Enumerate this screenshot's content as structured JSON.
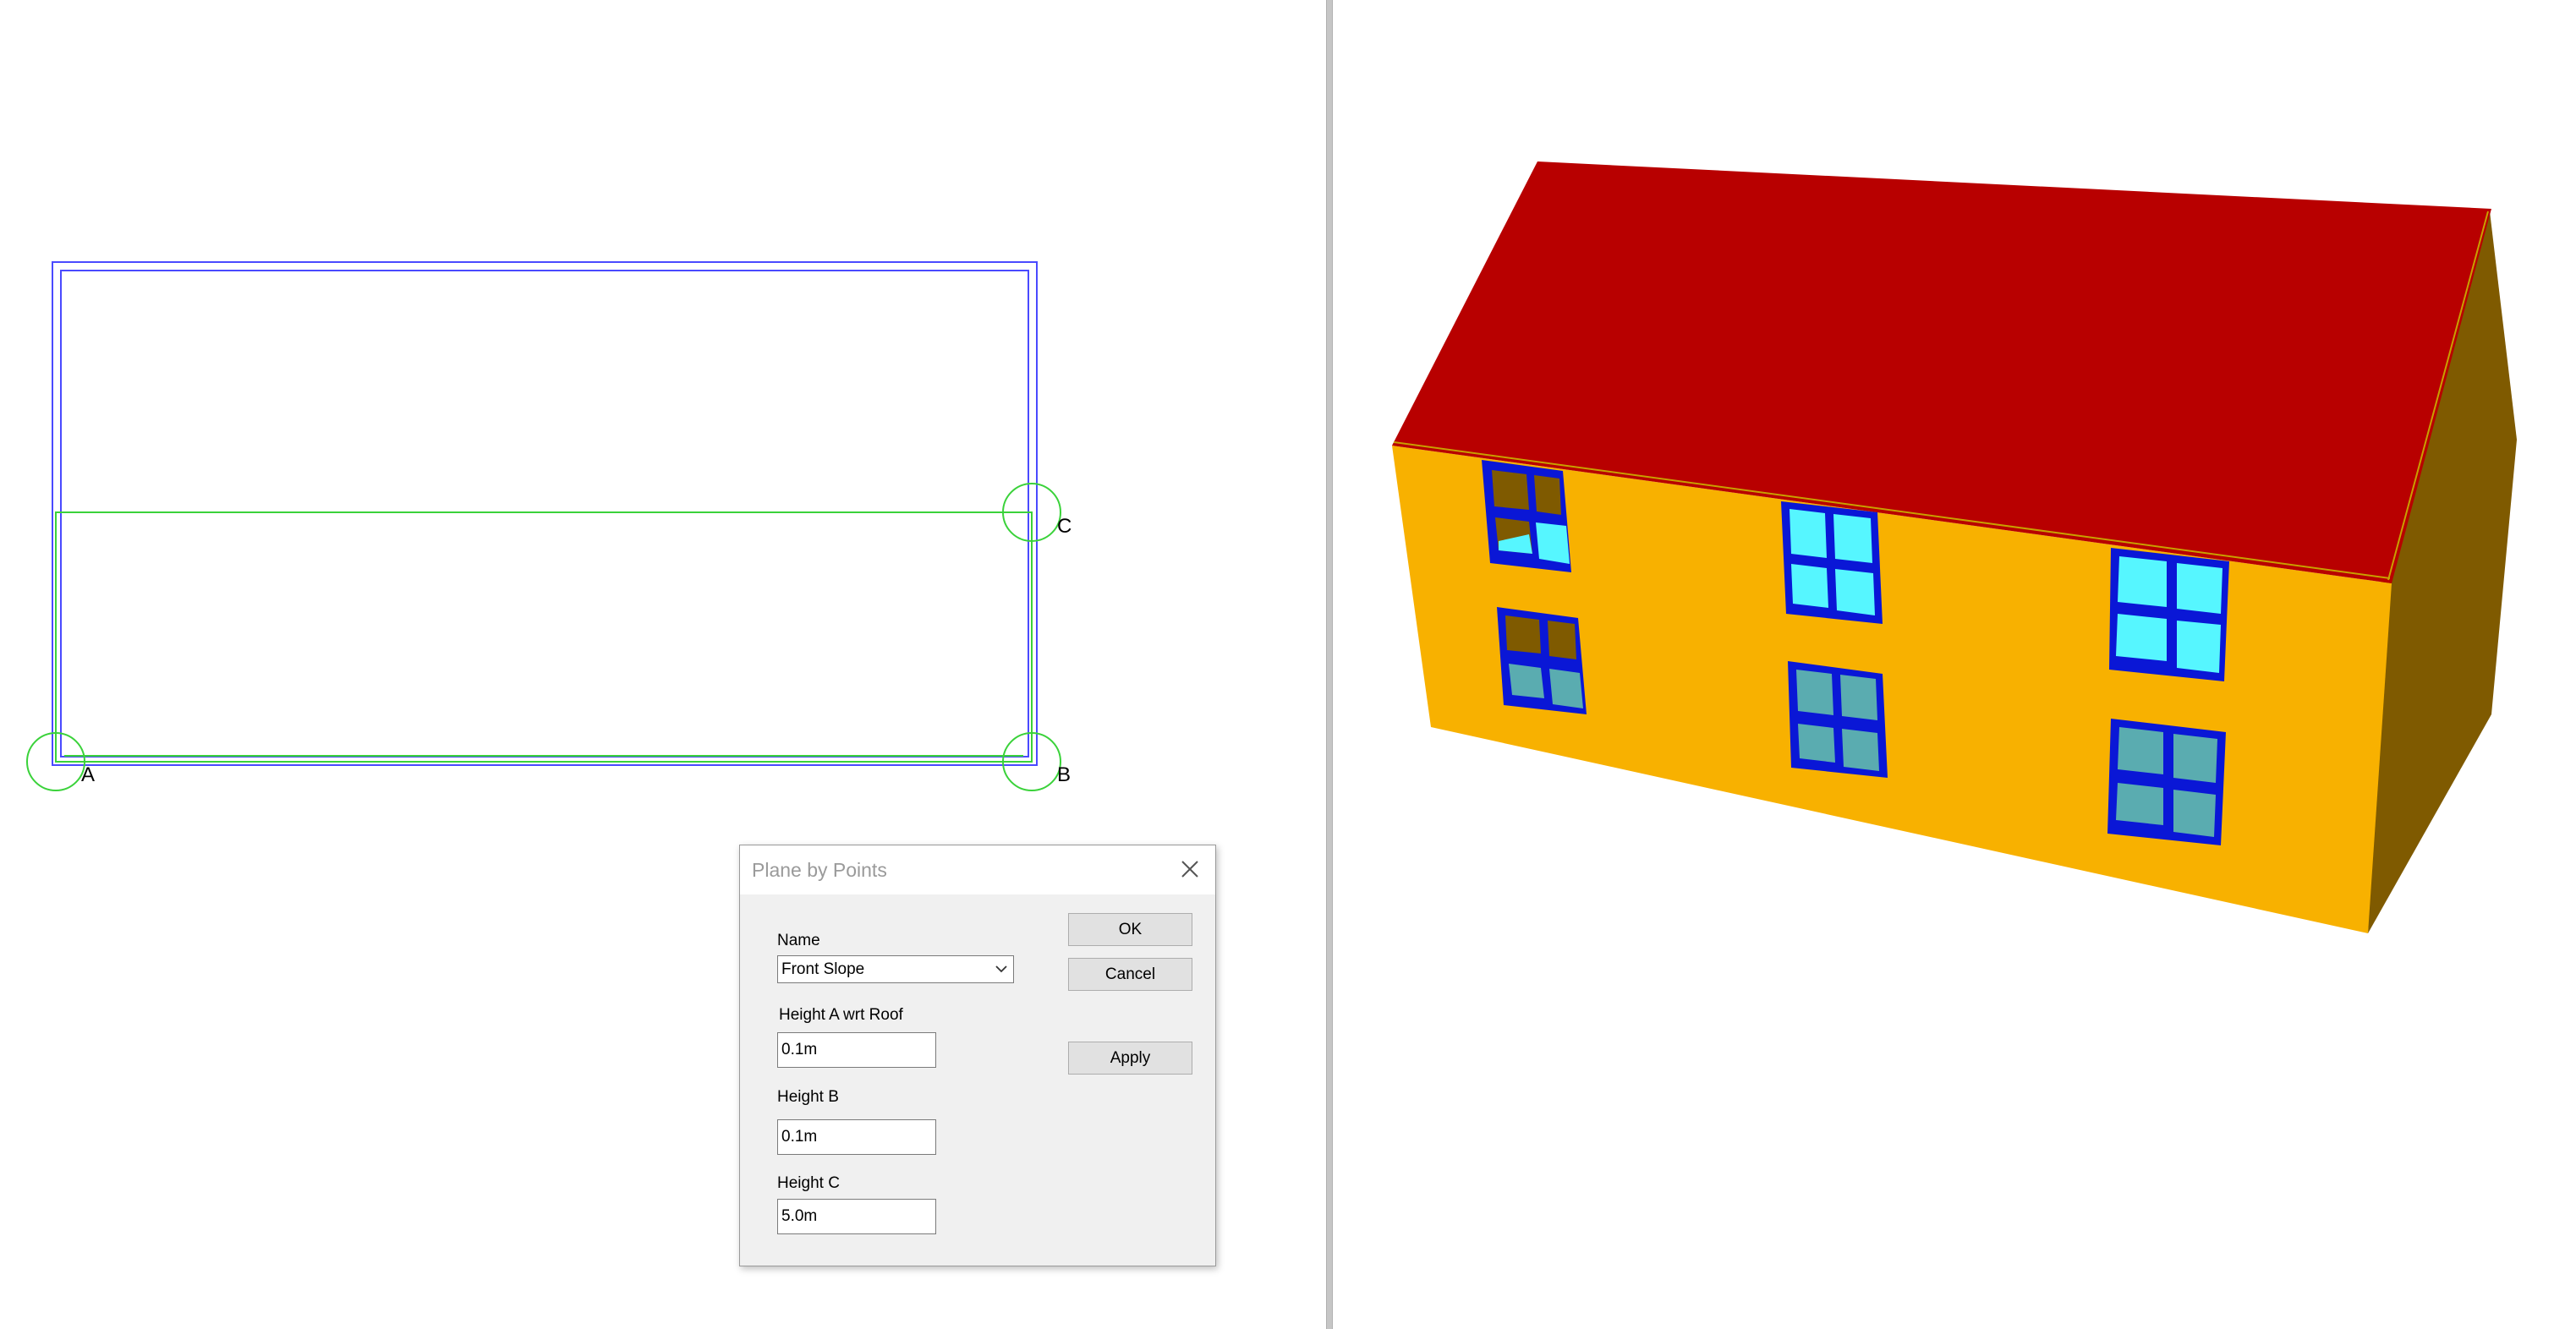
{
  "plan": {
    "points": [
      {
        "label": "A"
      },
      {
        "label": "B"
      },
      {
        "label": "C"
      }
    ],
    "colors": {
      "outline": "#4a4aff",
      "selection": "#3ad23a"
    }
  },
  "dialog": {
    "title": "Plane by Points",
    "name_label": "Name",
    "name_value": "Front Slope",
    "height_a_label": "Height A wrt Roof",
    "height_a_value": "0.1m",
    "height_b_label": "Height B",
    "height_b_value": "0.1m",
    "height_c_label": "Height C",
    "height_c_value": "5.0m",
    "ok_label": "OK",
    "cancel_label": "Cancel",
    "apply_label": "Apply"
  },
  "view3d": {
    "colors": {
      "roof": "#b80000",
      "front_wall": "#f8b100",
      "side_wall": "#7f5a00",
      "window_frame": "#0a17d6",
      "glass_lit": "#56f6ff",
      "glass_shaded": "#5aacb0"
    }
  }
}
